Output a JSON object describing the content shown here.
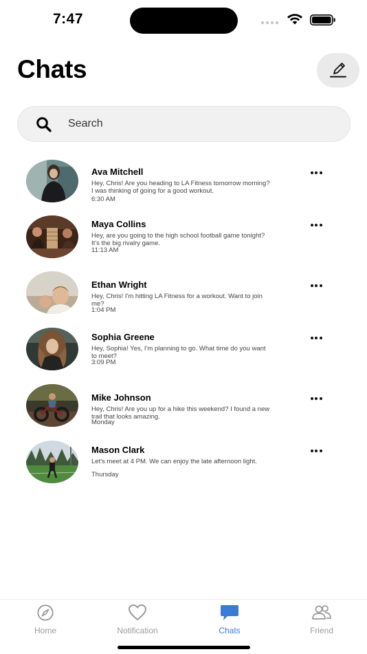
{
  "status_bar": {
    "time": "7:47"
  },
  "header": {
    "title": "Chats"
  },
  "search": {
    "placeholder": "Search"
  },
  "chats": [
    {
      "name": "Ava Mitchell",
      "message": "Hey, Chris! Are you heading to LA Fitness tomorrow morning? I was thinking of going for a good workout.",
      "time": "6:30 AM"
    },
    {
      "name": "Maya Collins",
      "message": "Hey, are you going to the high school football game tonight? It's the big rivalry game.",
      "time": "11:13 AM"
    },
    {
      "name": "Ethan Wright",
      "message": "Hey, Chris! I'm hitting LA Fitness for a workout. Want to join me?",
      "time": "1:04 PM"
    },
    {
      "name": "Sophia Greene",
      "message": "Hey, Sophia! Yes, I'm planning to go. What time do you want to meet?",
      "time": "3:09 PM"
    },
    {
      "name": "Mike Johnson",
      "message": "Hey, Chris! Are you up for a hike this weekend? I found a new trail that looks amazing.",
      "time": "Monday"
    },
    {
      "name": "Mason Clark",
      "message": "Let's meet at 4 PM. We can enjoy the late afternoon light.",
      "time": "Thursday"
    }
  ],
  "tabs": [
    {
      "label": "Home",
      "icon": "compass-icon",
      "active": false
    },
    {
      "label": "Notification",
      "icon": "heart-icon",
      "active": false
    },
    {
      "label": "Chats",
      "icon": "chat-bubble-icon",
      "active": true
    },
    {
      "label": "Friend",
      "icon": "people-icon",
      "active": false
    }
  ],
  "colors": {
    "accent": "#3a7bd5",
    "inactive": "#9a9a9a",
    "search_bg": "#f1f1f1"
  }
}
